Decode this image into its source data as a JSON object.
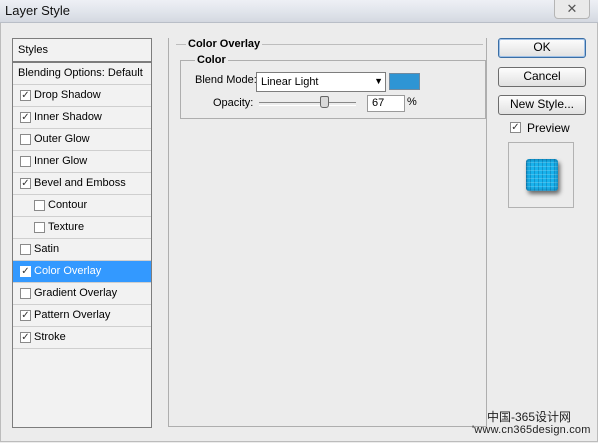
{
  "window": {
    "title": "Layer Style",
    "close_symbol": "✕"
  },
  "styles_header": "Styles",
  "items": [
    {
      "label": "Blending Options: Default",
      "checkbox": false,
      "checked": false,
      "selected": false,
      "indent": 0
    },
    {
      "label": "Drop Shadow",
      "checkbox": true,
      "checked": true,
      "selected": false,
      "indent": 0
    },
    {
      "label": "Inner Shadow",
      "checkbox": true,
      "checked": true,
      "selected": false,
      "indent": 0
    },
    {
      "label": "Outer Glow",
      "checkbox": true,
      "checked": false,
      "selected": false,
      "indent": 0
    },
    {
      "label": "Inner Glow",
      "checkbox": true,
      "checked": false,
      "selected": false,
      "indent": 0
    },
    {
      "label": "Bevel and Emboss",
      "checkbox": true,
      "checked": true,
      "selected": false,
      "indent": 0
    },
    {
      "label": "Contour",
      "checkbox": true,
      "checked": false,
      "selected": false,
      "indent": 1
    },
    {
      "label": "Texture",
      "checkbox": true,
      "checked": false,
      "selected": false,
      "indent": 1
    },
    {
      "label": "Satin",
      "checkbox": true,
      "checked": false,
      "selected": false,
      "indent": 0
    },
    {
      "label": "Color Overlay",
      "checkbox": true,
      "checked": true,
      "selected": true,
      "indent": 0
    },
    {
      "label": "Gradient Overlay",
      "checkbox": true,
      "checked": false,
      "selected": false,
      "indent": 0
    },
    {
      "label": "Pattern Overlay",
      "checkbox": true,
      "checked": true,
      "selected": false,
      "indent": 0
    },
    {
      "label": "Stroke",
      "checkbox": true,
      "checked": true,
      "selected": false,
      "indent": 0
    }
  ],
  "color_overlay": {
    "group_title": "Color Overlay",
    "color_section": "Color",
    "blend_mode_label": "Blend Mode:",
    "blend_mode_value": "Linear Light",
    "overlay_color": "#2e95d4",
    "opacity_label": "Opacity:",
    "opacity_value": "67",
    "opacity_unit": "%",
    "opacity_fraction": 0.67
  },
  "buttons": {
    "ok": "OK",
    "cancel": "Cancel",
    "new_style": "New Style..."
  },
  "preview": {
    "label": "Preview",
    "checked": true
  },
  "watermark": {
    "line1": "中国-365设计网",
    "line2": "'www.cn365design.com"
  },
  "colors": {
    "selection": "#3399ff",
    "preview_tile": "#18b2ec"
  }
}
